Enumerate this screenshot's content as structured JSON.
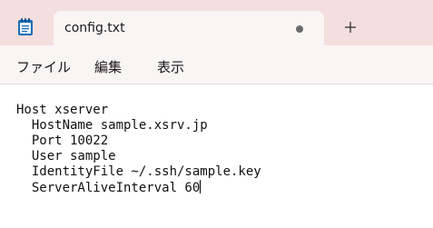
{
  "tab": {
    "title": "config.txt",
    "icon": "notepad-icon",
    "unsaved_indicator": "dot",
    "new_tab_icon": "plus-icon"
  },
  "menu": {
    "file": "ファイル",
    "edit": "編集",
    "view": "表示"
  },
  "editor": {
    "lines": [
      "Host xserver",
      "  HostName sample.xsrv.jp",
      "  Port 10022",
      "  User sample",
      "  IdentityFile ~/.ssh/sample.key",
      "  ServerAliveInterval 60"
    ]
  },
  "colors": {
    "titlebar": "#f4dede",
    "tab": "#faf5f5",
    "editor_bg": "#ffffff",
    "text": "#111111",
    "icon_blue": "#1b6fb8"
  }
}
